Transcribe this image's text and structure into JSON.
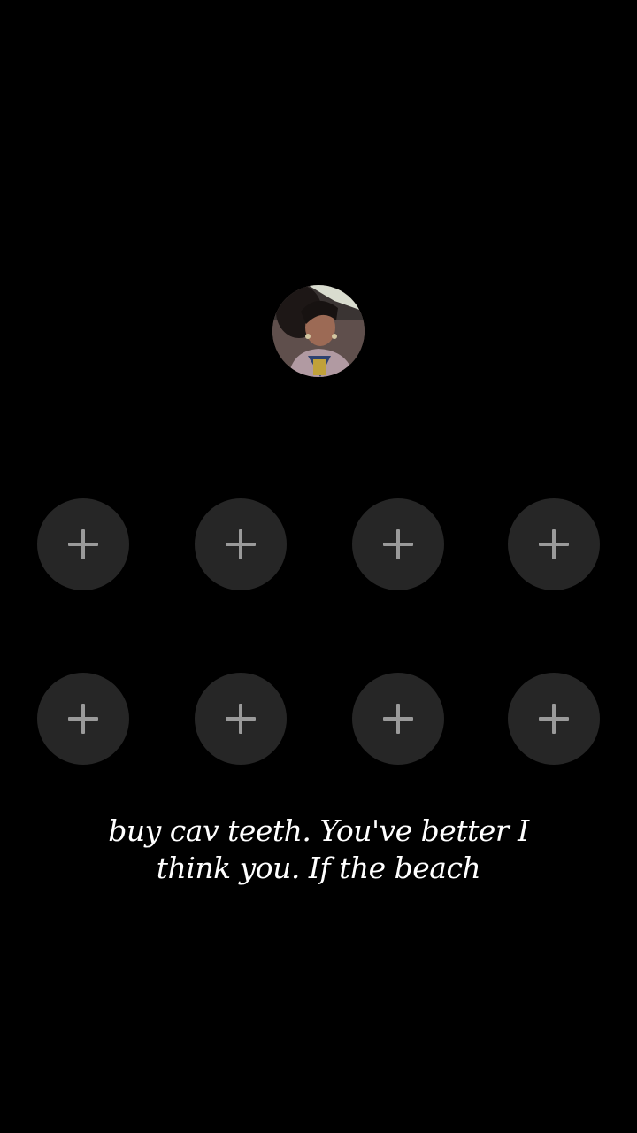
{
  "profile": {
    "avatar_icon": "user-photo"
  },
  "slots": [
    {
      "icon": "plus-icon"
    },
    {
      "icon": "plus-icon"
    },
    {
      "icon": "plus-icon"
    },
    {
      "icon": "plus-icon"
    },
    {
      "icon": "plus-icon"
    },
    {
      "icon": "plus-icon"
    },
    {
      "icon": "plus-icon"
    },
    {
      "icon": "plus-icon"
    }
  ],
  "caption": {
    "line1": "buy cav teeth. You've better I",
    "line2": "think you. If the beach"
  },
  "colors": {
    "background": "#000000",
    "slot": "#262626",
    "plus": "#9a9a9a",
    "caption": "#ffffff"
  }
}
